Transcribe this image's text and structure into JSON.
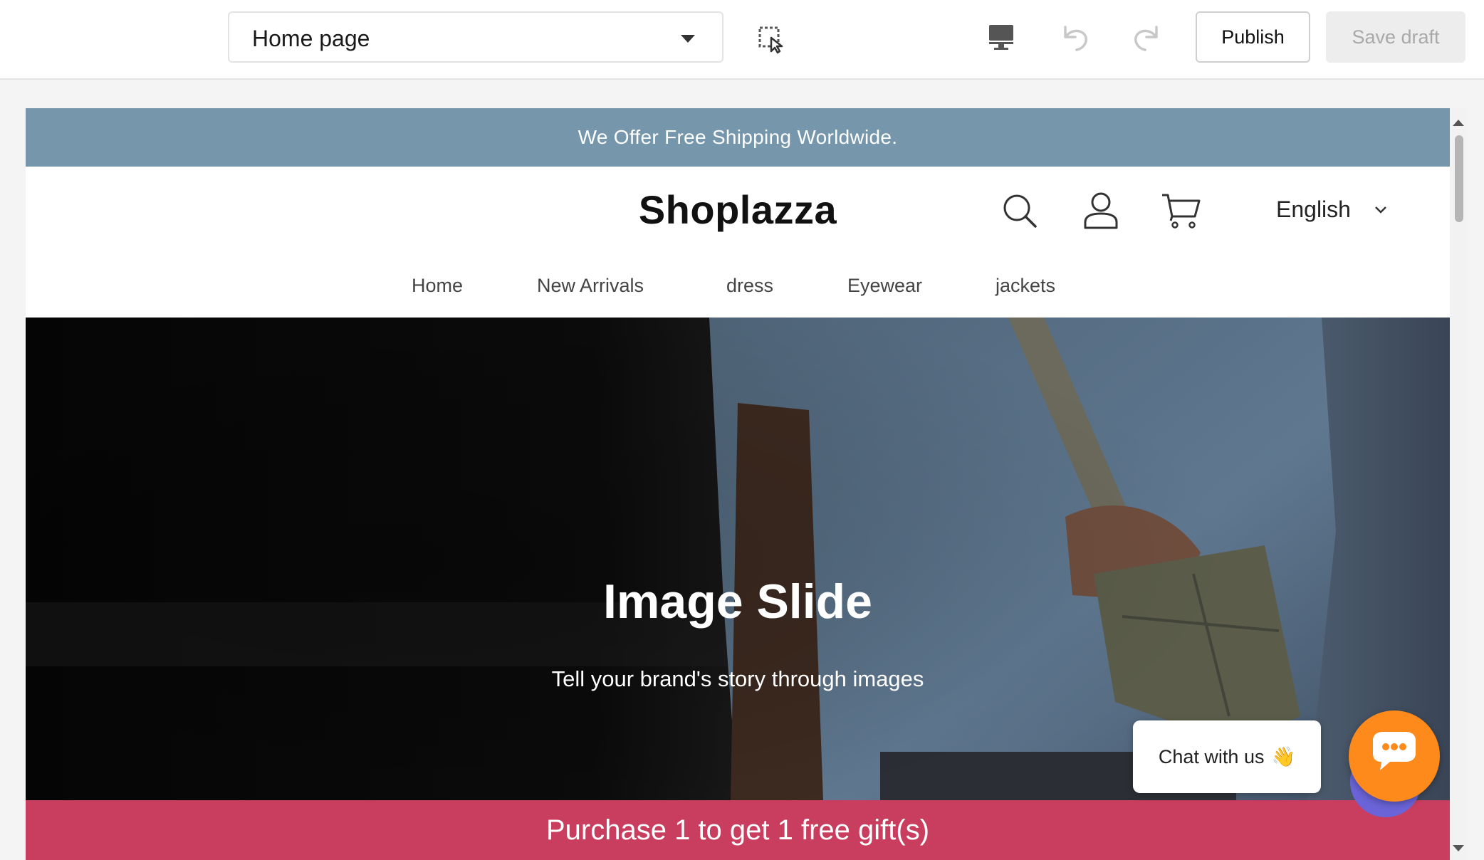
{
  "editor": {
    "page_select": {
      "value": "Home page",
      "caret_icon": "caret-down-icon"
    },
    "tools": {
      "select_icon": "element-select-icon",
      "device_icon": "desktop-icon",
      "undo_icon": "undo-icon",
      "redo_icon": "redo-icon"
    },
    "publish_label": "Publish",
    "save_draft_label": "Save draft"
  },
  "store": {
    "announcement": "We Offer Free Shipping Worldwide.",
    "logo": "Shoplazza",
    "language": "English",
    "nav": [
      "Home",
      "New Arrivals",
      "dress",
      "Eyewear",
      "jackets"
    ],
    "hero": {
      "title": "Image Slide",
      "subtitle": "Tell your brand's story through images"
    },
    "promo": "Purchase 1 to get 1 free gift(s)",
    "chat": {
      "label": "Chat with us",
      "emoji": "👋"
    }
  },
  "colors": {
    "announcement_bg": "#7596ab",
    "promo_bg": "#c93d5e",
    "chat_fab": "#ff8a1c"
  }
}
